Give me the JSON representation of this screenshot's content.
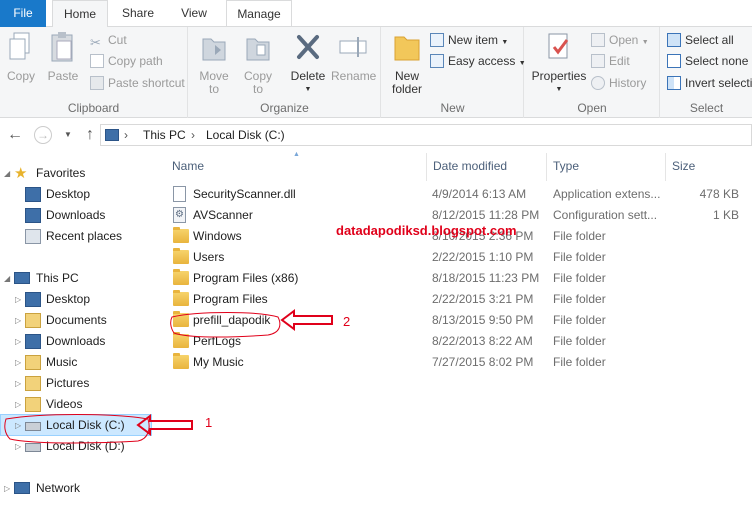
{
  "ribbon_tabs": {
    "file": "File",
    "home": "Home",
    "share": "Share",
    "view": "View",
    "manage": "Manage"
  },
  "clipboard": {
    "copy": "Copy",
    "paste": "Paste",
    "cut": "Cut",
    "copy_path": "Copy path",
    "paste_shortcut": "Paste shortcut",
    "label": "Clipboard"
  },
  "organize": {
    "move_to_1": "Move",
    "move_to_2": "to",
    "copy_to_1": "Copy",
    "copy_to_2": "to",
    "delete": "Delete",
    "rename": "Rename",
    "label": "Organize"
  },
  "new": {
    "folder_1": "New",
    "folder_2": "folder",
    "new_item": "New item",
    "easy_access": "Easy access",
    "label": "New"
  },
  "open": {
    "properties": "Properties",
    "open": "Open",
    "edit": "Edit",
    "history": "History",
    "label": "Open"
  },
  "select": {
    "select_all": "Select all",
    "select_none": "Select none",
    "invert": "Invert selection",
    "label": "Select"
  },
  "address": {
    "this_pc": "This PC",
    "local_disk": "Local Disk (C:)"
  },
  "nav": {
    "favorites": "Favorites",
    "desktop": "Desktop",
    "downloads": "Downloads",
    "recent": "Recent places",
    "this_pc": "This PC",
    "pc_desktop": "Desktop",
    "documents": "Documents",
    "pc_downloads": "Downloads",
    "music": "Music",
    "pictures": "Pictures",
    "videos": "Videos",
    "local_c": "Local Disk (C:)",
    "local_d": "Local Disk (D:)",
    "network": "Network"
  },
  "columns": {
    "name": "Name",
    "date": "Date modified",
    "type": "Type",
    "size": "Size"
  },
  "files": [
    {
      "name": "SecurityScanner.dll",
      "date": "4/9/2014 6:13 AM",
      "type": "Application extens...",
      "size": "478 KB",
      "kind": "dll"
    },
    {
      "name": "AVScanner",
      "date": "8/12/2015 11:28 PM",
      "type": "Configuration sett...",
      "size": "1 KB",
      "kind": "config"
    },
    {
      "name": "Windows",
      "date": "8/10/2015 2:36 PM",
      "type": "File folder",
      "size": "",
      "kind": "folder"
    },
    {
      "name": "Users",
      "date": "2/22/2015 1:10 PM",
      "type": "File folder",
      "size": "",
      "kind": "folder"
    },
    {
      "name": "Program Files (x86)",
      "date": "8/18/2015 11:23 PM",
      "type": "File folder",
      "size": "",
      "kind": "folder"
    },
    {
      "name": "Program Files",
      "date": "2/22/2015 3:21 PM",
      "type": "File folder",
      "size": "",
      "kind": "folder"
    },
    {
      "name": "prefill_dapodik",
      "date": "8/13/2015 9:50 PM",
      "type": "File folder",
      "size": "",
      "kind": "folder"
    },
    {
      "name": "PerfLogs",
      "date": "8/22/2013 8:22 AM",
      "type": "File folder",
      "size": "",
      "kind": "folder"
    },
    {
      "name": "My Music",
      "date": "7/27/2015 8:02 PM",
      "type": "File folder",
      "size": "",
      "kind": "folder"
    }
  ],
  "watermark": "datadapodiksd.blogspot.com",
  "annotations": {
    "one": "1",
    "two": "2"
  },
  "colors": {
    "accent": "#1979ca",
    "selection": "#cce8ff",
    "annotation_red": "#e0001a",
    "folder": "#e9b43d"
  }
}
